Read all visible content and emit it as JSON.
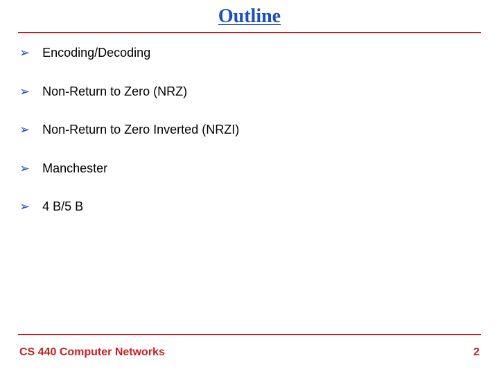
{
  "title": "Outline",
  "bullets": [
    "Encoding/Decoding",
    "Non-Return to Zero (NRZ)",
    "Non-Return to Zero Inverted (NRZI)",
    "Manchester",
    "4 B/5 B"
  ],
  "bullet_glyph": "➢",
  "footer": {
    "course": "CS 440 Computer Networks",
    "page": "2"
  }
}
